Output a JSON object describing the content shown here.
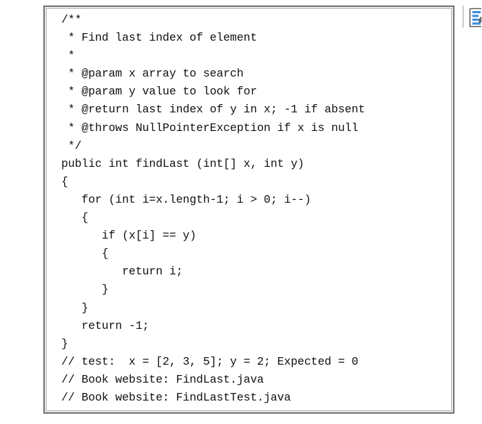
{
  "document": {
    "background_color": "#ffffff",
    "panel": {
      "border_color": "#6b6b6b",
      "inner_border_color": "#c9c9c9",
      "background_color": "#ffffff"
    }
  },
  "code": {
    "language": "java",
    "text_color": "#101010",
    "lines": [
      "/**",
      " * Find last index of element",
      " *",
      " * @param x array to search",
      " * @param y value to look for",
      " * @return last index of y in x; -1 if absent",
      " * @throws NullPointerException if x is null",
      " */",
      "public int findLast (int[] x, int y)",
      "{",
      "   for (int i=x.length-1; i > 0; i--)",
      "   {",
      "      if (x[i] == y)",
      "      {",
      "         return i;",
      "      }",
      "   }",
      "   return -1;",
      "}",
      "// test:  x = [2, 3, 5]; y = 2; Expected = 0",
      "// Book website: FindLast.java",
      "// Book website: FindLastTest.java"
    ]
  },
  "icons": {
    "doc_list": {
      "name": "document-list-icon",
      "bar_color": "#3a8dde",
      "outline_color": "#5a5a5a",
      "chart_color": "#3a3a3a"
    }
  }
}
